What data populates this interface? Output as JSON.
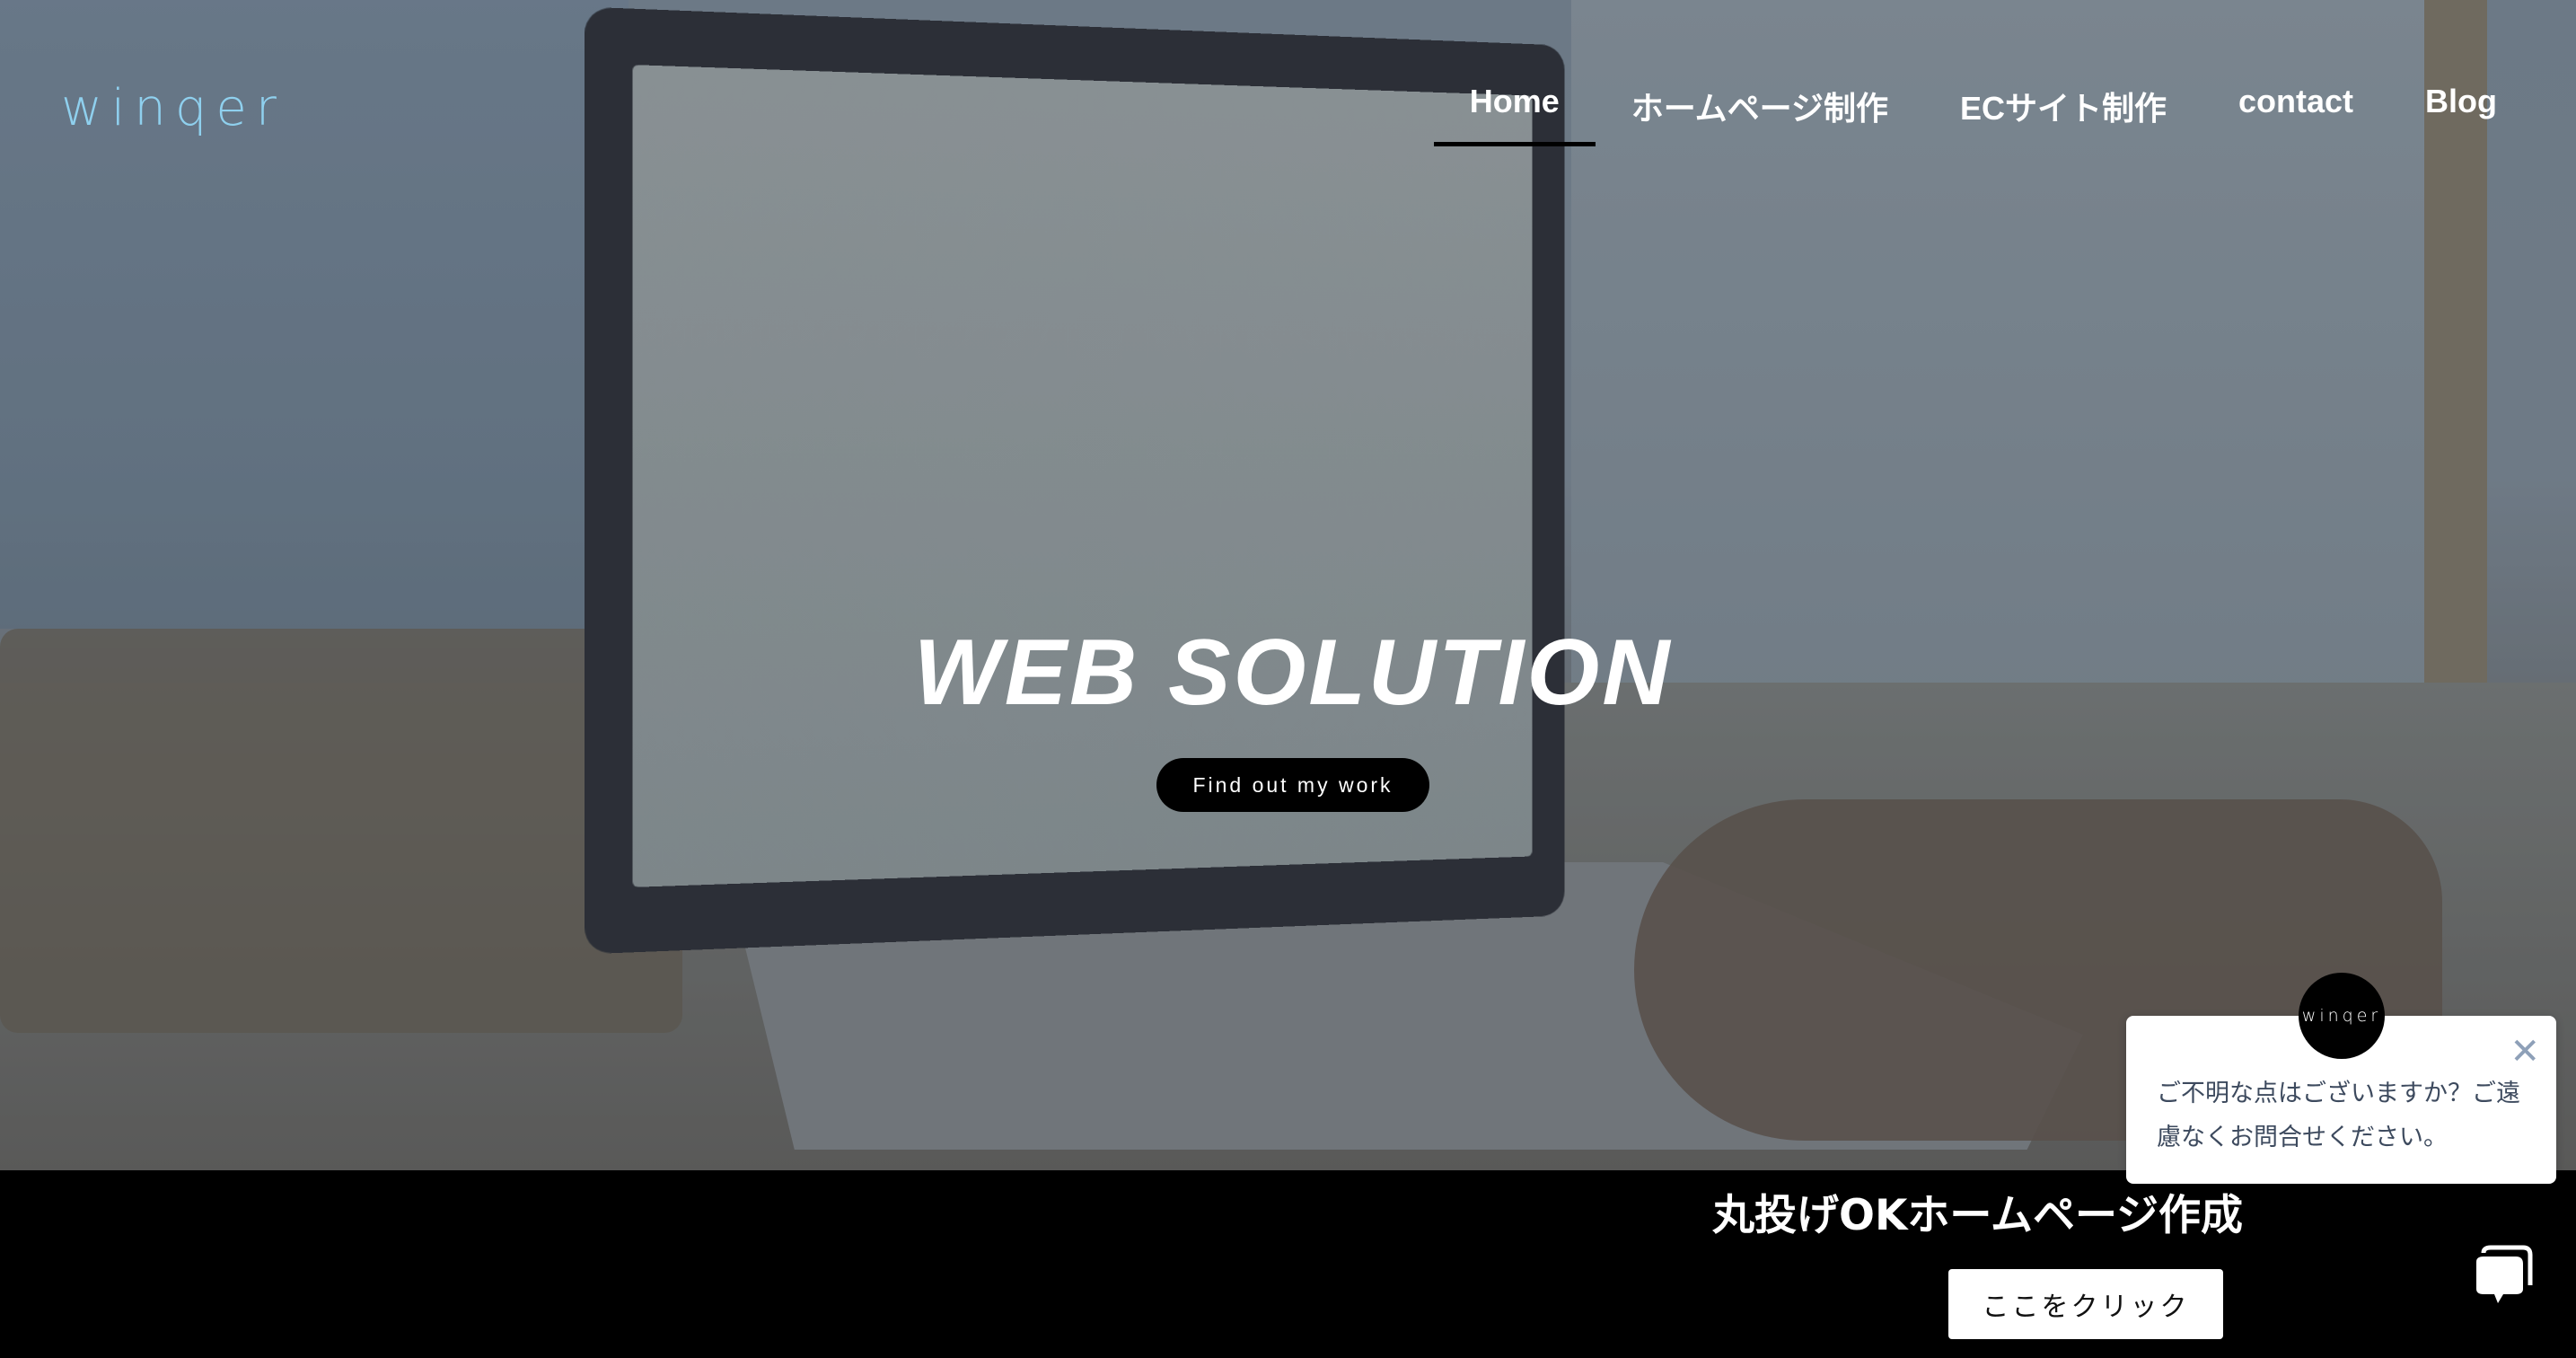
{
  "header": {
    "logo": "winqer",
    "nav": [
      {
        "label": "Home",
        "active": true
      },
      {
        "label": "ホームページ制作"
      },
      {
        "label": "ECサイト制作"
      },
      {
        "label": "contact"
      },
      {
        "label": "Blog"
      }
    ]
  },
  "hero": {
    "title": "WEB SOLUTION",
    "button": "Find out my work"
  },
  "band": {
    "title": "丸投げOKホームページ作成",
    "button": "ここをクリック"
  },
  "chat_popup": {
    "avatar": "winqer",
    "message": "ご不明な点はございますか？ご遠慮なくお問合せください。",
    "close_icon": "close-icon",
    "chat_icon": "chat-bubble-icon"
  },
  "colors": {
    "logo": "#8fd0ee",
    "band": "#000000",
    "nav_underline": "#000000"
  }
}
